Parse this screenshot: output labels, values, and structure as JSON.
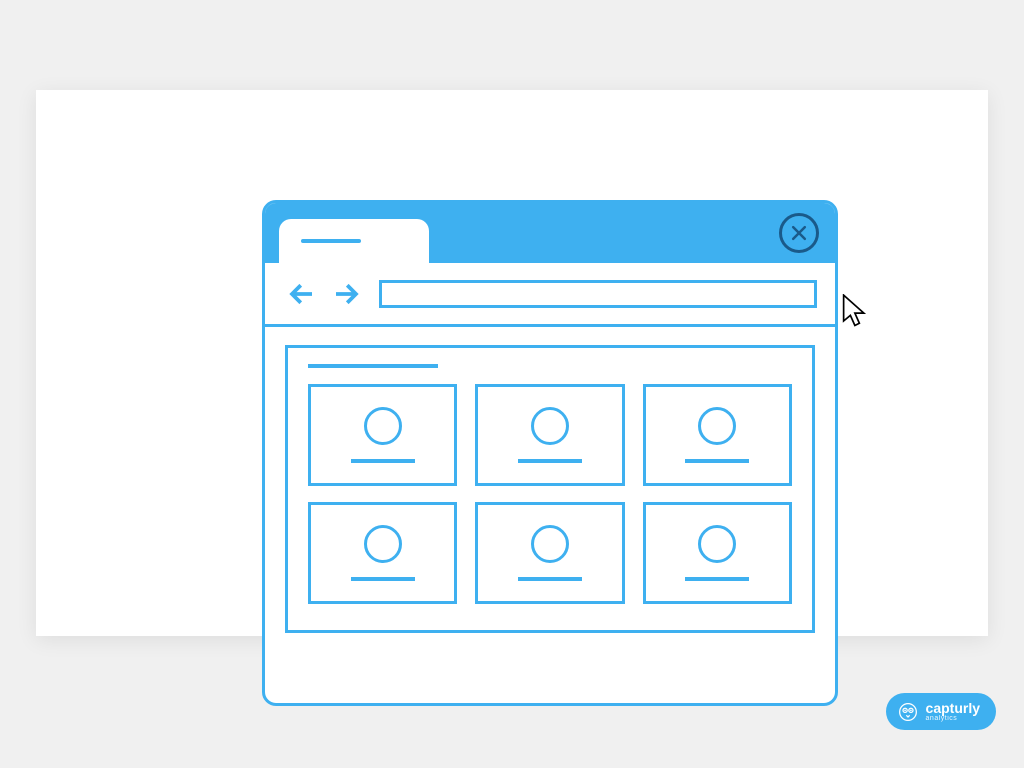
{
  "brand": {
    "name": "capturly",
    "subline": "analytics"
  },
  "colors": {
    "primary": "#3eb0f0",
    "darkOutline": "#1a5a8a",
    "canvas": "#ffffff"
  },
  "browser": {
    "tab": {
      "label": ""
    },
    "addressBar": {
      "value": ""
    },
    "closeIcon": "close-icon",
    "backIcon": "arrow-left-icon",
    "forwardIcon": "arrow-right-icon",
    "content": {
      "title": "",
      "cards": [
        {
          "label": ""
        },
        {
          "label": ""
        },
        {
          "label": ""
        },
        {
          "label": ""
        },
        {
          "label": ""
        },
        {
          "label": ""
        }
      ]
    }
  }
}
